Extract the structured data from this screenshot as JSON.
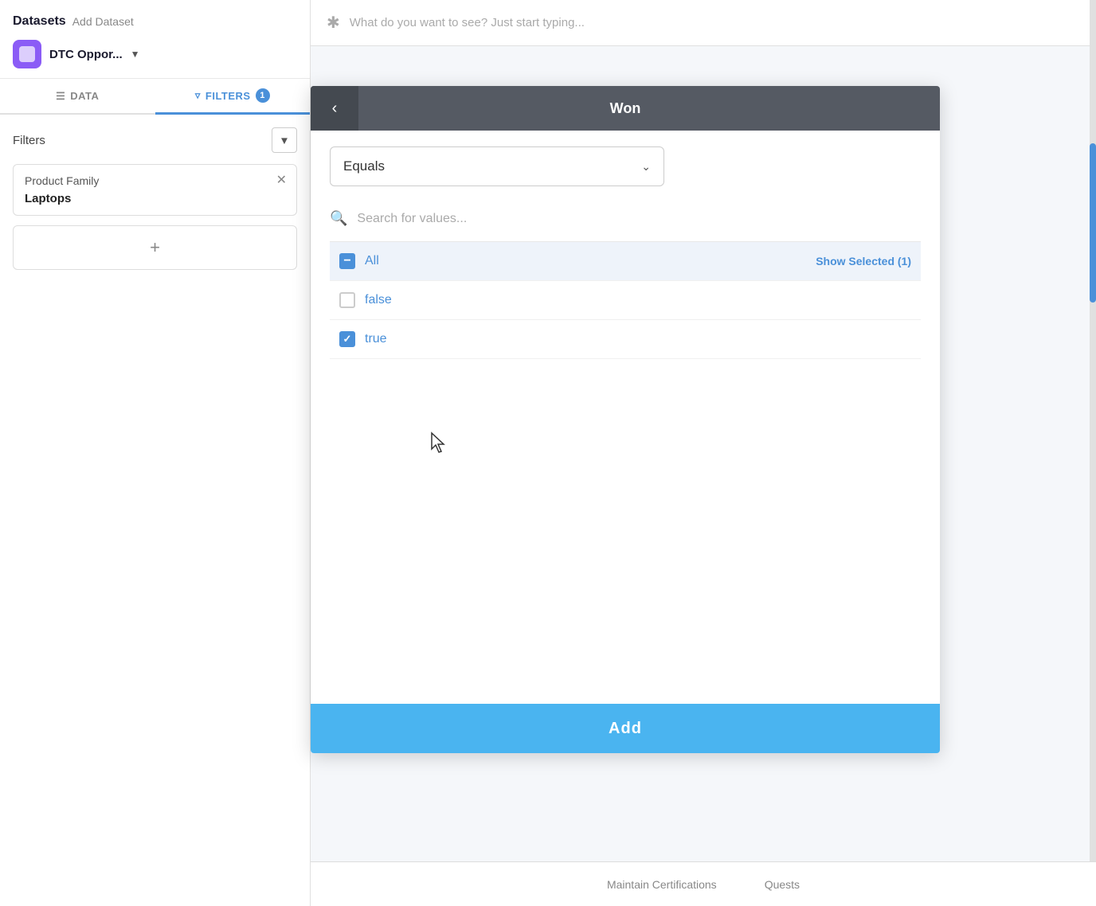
{
  "sidebar": {
    "datasets_label": "Datasets",
    "add_dataset_label": "Add Dataset",
    "dataset_name": "DTC Oppor...",
    "tab_data_label": "DATA",
    "tab_filters_label": "FILTERS",
    "tab_filters_count": "1",
    "filters_title": "Filters",
    "filter1": {
      "label": "Product Family",
      "value": "Laptops"
    },
    "add_filter_label": "+"
  },
  "main": {
    "search_placeholder": "What do you want to see? Just start typing..."
  },
  "popup": {
    "title": "Won",
    "back_label": "<",
    "operator_label": "Equals",
    "search_placeholder": "Search for values...",
    "all_label": "All",
    "show_selected_label": "Show Selected (1)",
    "false_label": "false",
    "true_label": "true",
    "add_button_label": "Add"
  },
  "bottom_bar": {
    "item1": "Maintain Certifications",
    "item2": "Quests"
  }
}
